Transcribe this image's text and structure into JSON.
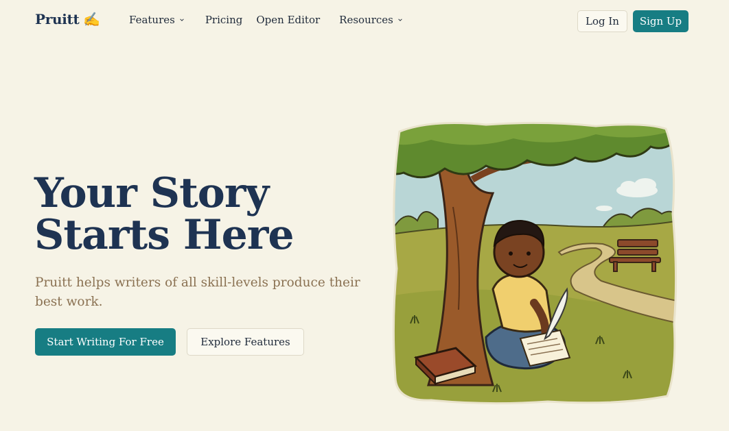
{
  "brand": {
    "name": "Pruitt",
    "glyph": "✍"
  },
  "nav": {
    "links": [
      {
        "label": "Features",
        "has_dropdown": true
      },
      {
        "label": "Pricing",
        "has_dropdown": false
      },
      {
        "label": "Open Editor",
        "has_dropdown": false
      },
      {
        "label": "Resources",
        "has_dropdown": true
      }
    ],
    "login_label": "Log In",
    "signup_label": "Sign Up"
  },
  "hero": {
    "title_line1": "Your Story",
    "title_line2": "Starts Here",
    "subtitle": "Pruitt helps writers of all skill-levels produce their best work.",
    "primary_cta": "Start Writing For Free",
    "secondary_cta": "Explore Features"
  },
  "colors": {
    "background": "#f6f3e6",
    "accent_teal": "#177d83",
    "heading_navy": "#1e3352",
    "subtitle_brown": "#8a7152"
  },
  "icons": {
    "logo": "writing-hand-icon",
    "dropdown": "chevron-down-icon"
  }
}
